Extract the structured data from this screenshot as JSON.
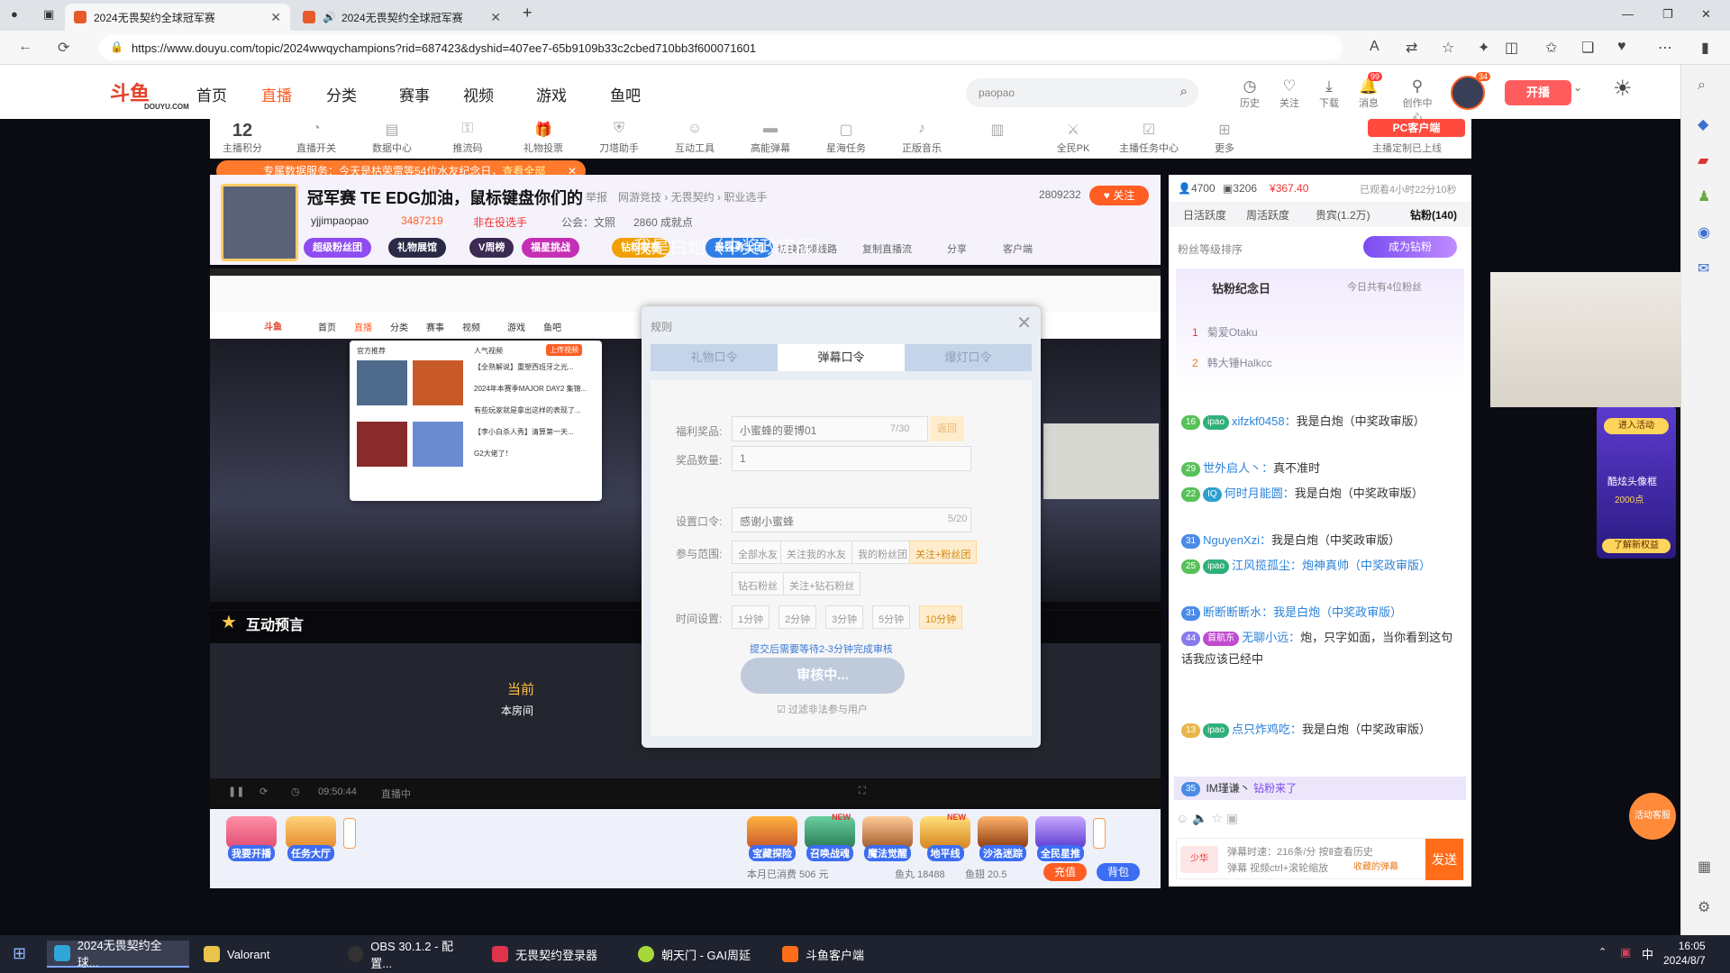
{
  "browser": {
    "tabs": [
      {
        "title": "2024无畏契约全球冠军赛",
        "active": true
      },
      {
        "title": "2024无畏契约全球冠军赛",
        "active": false
      }
    ],
    "url": "https://www.douyu.com/topic/2024wwqychampions?rid=687423&dyshid=407ee7-65b9109b33c2cbed710bb3f600071601"
  },
  "site": {
    "logo": "斗鱼",
    "logo_sub": "DOUYU.COM",
    "nav": [
      "首页",
      "直播",
      "分类",
      "赛事",
      "视频",
      "游戏",
      "鱼吧"
    ],
    "search_placeholder": "paopao",
    "header_icons": [
      "历史",
      "关注",
      "下载",
      "消息",
      "创作中心"
    ],
    "msg_count": "99",
    "avatar_badge": "34",
    "kaibo": "开播"
  },
  "tools": {
    "score_value": "12",
    "items": [
      "主播积分",
      "直播开关",
      "数据中心",
      "推流码",
      "礼物投票",
      "刀塔助手",
      "互动工具",
      "高能弹幕",
      "星海任务",
      "正版音乐",
      "全民PK",
      "主播任务中心",
      "更多"
    ],
    "pc_client": "PC客户端",
    "pc_client_note": "主播定制已上线"
  },
  "room": {
    "notice": "专属数据服务：今天是枯荣雷等54位水友纪念日，",
    "notice_link": "查看全部",
    "title": "冠军赛 TE EDG加油，鼠标键盘你们的",
    "report": "举报",
    "breadcrumb": "网游竞技 › 无畏契约 › 职业选手",
    "count": "2809232",
    "follow": "关注",
    "anchor": "yjjimpaopao",
    "heat": "3487219",
    "tag": "非在役选手",
    "guild": "公会：文照",
    "achievement": "2860 成就点",
    "pills": [
      "超级粉丝团",
      "礼物展馆",
      "V周榜",
      "福星挑战",
      "钻粉联赛",
      "最强勇士团"
    ],
    "right_links": [
      "切换音频线路",
      "复制直播流",
      "分享",
      "客户端"
    ]
  },
  "video": {
    "overlay_text": "我是白炮（中奖政审版）",
    "hudong": "互动预言",
    "inner_nav": [
      "首页",
      "直播",
      "分类",
      "赛事",
      "视频",
      "游戏",
      "鱼吧"
    ],
    "dropdown_left_title": "官方推荐",
    "dropdown_right_title": "人气视频",
    "dropdown_tag": "上传视频",
    "dropdown_items": [
      "【全熟解说】重塑西班牙之光...",
      "2024年本赛季MAJOR DAY2 集锦...",
      "有些玩家就是拿出这样的表现了...",
      "【李小白杀人秀】清算第一天...",
      "G2大佬了！"
    ],
    "stage_text_1": "当前",
    "stage_text_2": "本房间",
    "time": "09:50:44",
    "live_label": "直播中"
  },
  "modal": {
    "header": "规则",
    "tabs": [
      "礼物口令",
      "弹幕口令",
      "爆灯口令"
    ],
    "active_tab": 1,
    "prize_label": "福利奖品:",
    "prize_value": "小蜜蜂的要博01",
    "prize_count": "7/30",
    "prize_btn": "返回",
    "qty_label": "奖品数量:",
    "qty_value": "1",
    "code_label": "设置口令:",
    "code_value": "感谢小蜜蜂",
    "code_count": "5/20",
    "scope_label": "参与范围:",
    "scope_options": [
      "全部水友",
      "关注我的水友",
      "我的粉丝团",
      "关注+粉丝团",
      "钻石粉丝",
      "关注+钻石粉丝"
    ],
    "scope_selected": 3,
    "time_label": "时间设置:",
    "time_options": [
      "1分钟",
      "2分钟",
      "3分钟",
      "5分钟",
      "10分钟"
    ],
    "time_selected": 4,
    "review_note": "提交后需要等待2-3分钟完成审核",
    "submit": "审核中...",
    "filter": "过滤非法参与用户"
  },
  "giftbar": {
    "left": [
      "我要开播",
      "任务大厅"
    ],
    "gifts": [
      "宝藏探险",
      "召唤战魂",
      "魔法觉醒",
      "地平线",
      "沙洛迷踪",
      "全民星推"
    ],
    "new_tags": [
      "NEW",
      "NEW"
    ],
    "balance_text": "本月已消费 506 元",
    "fish_ball": "鱼丸 18488",
    "fish_wing": "鱼翅 20.5",
    "recharge": "充值",
    "bag": "背包"
  },
  "chat": {
    "stats": [
      "4700",
      "3206",
      "367.40"
    ],
    "live_time": "已观看4小时22分10秒",
    "tabs": [
      "日活跃度",
      "周活跃度",
      "贵宾(1.2万)",
      "钻粉(140)"
    ],
    "fan_rank_label": "粉丝等级排序",
    "become_diamond": "成为钻粉",
    "anniversary": "钻粉纪念日",
    "anniversary_note": "今日共有4位粉丝",
    "ranks": [
      {
        "no": "1",
        "name": "菊爱Otaku"
      },
      {
        "no": "2",
        "name": "韩大锤Halkcc"
      }
    ],
    "messages": [
      {
        "lv": "16",
        "fan": "ipao",
        "nick": "xifzkf0458：",
        "text": "我是白炮（中奖政审版）"
      },
      {
        "lv": "29",
        "fan": "",
        "nick": "世外启人丶：",
        "text": "真不准时"
      },
      {
        "lv": "22",
        "fan": "IQ",
        "nick": "何时月能圆：",
        "text": "我是白炮（中奖政审版）"
      },
      {
        "lv": "31",
        "fan": "",
        "nick": "NguyenXzi：",
        "text": "我是白炮（中奖政审版）"
      },
      {
        "lv": "25",
        "fan": "ipao",
        "nick": "江风揽孤尘：",
        "text": "炮神真帅（中奖政审版）"
      },
      {
        "lv": "31",
        "fan": "",
        "nick": "断断断断水：",
        "text": "我是白炮（中奖政审版）"
      },
      {
        "lv": "44",
        "fan": "首航东",
        "nick": "无聊小远：",
        "text": "炮，只字如面，当你看到这句话我应该已经中"
      },
      {
        "lv": "13",
        "fan": "ipao",
        "nick": "点只炸鸡吃：",
        "text": "我是白炮（中奖政审版）"
      }
    ],
    "enter_msg": {
      "lv": "35",
      "nick": "IM瑾谦丶",
      "text": "钻粉来了"
    },
    "input_hint_1": "弹幕时速：216条/分 按Ⅱ查看历史",
    "input_hint_2": "弹幕 视频ctrl+滚轮缩放",
    "bubble": "收藏的弹幕",
    "send": "发送",
    "color_btn": "少华"
  },
  "side_promo": {
    "enter": "进入活动",
    "title": "酷炫头像框",
    "price": "2000点",
    "more": "了解新权益",
    "service": "活动客服"
  },
  "taskbar": {
    "items": [
      "2024无畏契约全球...",
      "Valorant",
      "OBS 30.1.2 - 配置...",
      "无畏契约登录器",
      "朝天门 - GAI周延",
      "斗鱼客户端"
    ],
    "ime": "中",
    "time": "16:05",
    "date": "2024/8/7"
  },
  "colors": {
    "brand": "#ff5d23",
    "send": "#ff6d1a",
    "pill_blue": "#3d6df2"
  }
}
